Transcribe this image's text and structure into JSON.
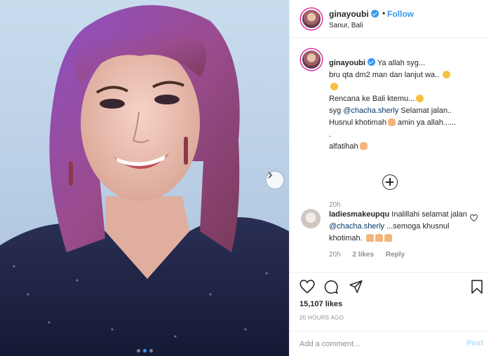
{
  "post": {
    "username": "ginayoubi",
    "separator": "•",
    "follow_label": "Follow",
    "location": "Sanur, Bali",
    "more_label": "•••"
  },
  "caption": {
    "username": "ginayoubi",
    "lines": [
      "Ya allah syg...",
      "bru qta dm2 man dan lanjut wa..",
      "",
      "Rencana ke Bali ktemu...",
      "syg",
      "@chacha.sherly",
      "Selamat jalan..",
      "Husnul khotimah",
      "amin ya allah......",
      ".",
      "alfatihah"
    ],
    "time": "20h"
  },
  "comment": {
    "username": "ladiesmakeupqu",
    "text_before": "Inalillahi selamat jalan",
    "mention": "@chacha.sherly",
    "text_after": "...semoga khusnul khotimah.",
    "time": "20h",
    "likes": "2 likes",
    "reply_label": "Reply"
  },
  "stats": {
    "likes": "15,107 likes",
    "time_ago": "20 HOURS AGO"
  },
  "add_comment": {
    "placeholder": "Add a comment...",
    "post_label": "Post"
  },
  "carousel": {
    "total": 3,
    "active_index": 1
  },
  "colors": {
    "accent": "#3897f0",
    "mention": "#00376b",
    "muted": "#8e8e8e",
    "post_disabled": "#b2dffc"
  }
}
